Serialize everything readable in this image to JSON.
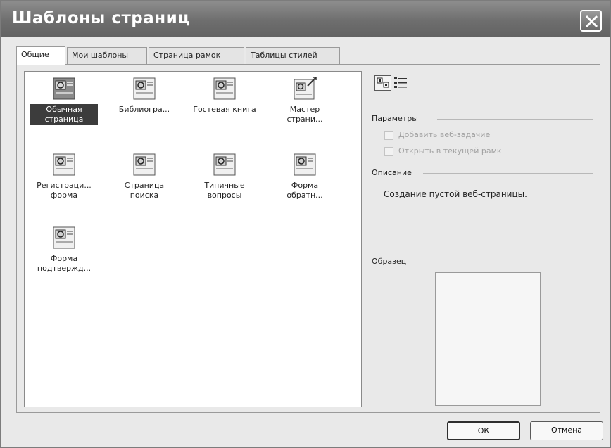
{
  "window": {
    "title": "Шаблоны страниц"
  },
  "tabs": [
    {
      "label": "Общие",
      "active": true
    },
    {
      "label": "Мои шаблоны",
      "active": false
    },
    {
      "label": "Страница рамок",
      "active": false
    },
    {
      "label": "Таблицы стилей",
      "active": false
    }
  ],
  "templates": [
    {
      "label": "Обычная страница",
      "selected": true,
      "icon": "blank-page-icon"
    },
    {
      "label": "Библиогра...",
      "selected": false,
      "icon": "page-template-icon"
    },
    {
      "label": "Гостевая книга",
      "selected": false,
      "icon": "page-template-icon"
    },
    {
      "label": "Мастер страни...",
      "selected": false,
      "icon": "wizard-page-icon"
    },
    {
      "label": "Регистраци... форма",
      "selected": false,
      "icon": "page-template-icon"
    },
    {
      "label": "Страница поиска",
      "selected": false,
      "icon": "page-template-icon"
    },
    {
      "label": "Типичные вопросы",
      "selected": false,
      "icon": "page-template-icon"
    },
    {
      "label": "Форма обратн...",
      "selected": false,
      "icon": "page-template-icon"
    },
    {
      "label": "Форма подтвержд...",
      "selected": false,
      "icon": "page-template-icon"
    }
  ],
  "view_modes": [
    "large-icons-view-icon",
    "details-view-icon"
  ],
  "options": {
    "title": "Параметры",
    "add_task": "Добавить веб-задачие",
    "open_in_frame": "Открыть в текущей рамк"
  },
  "description": {
    "title": "Описание",
    "text": "Создание пустой веб-страницы."
  },
  "preview": {
    "title": "Образец"
  },
  "buttons": {
    "ok": "ОК",
    "cancel": "Отмена"
  }
}
